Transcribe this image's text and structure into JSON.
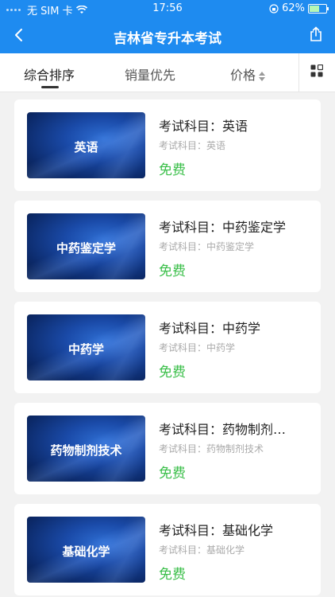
{
  "status": {
    "carrier": "无 SIM 卡",
    "time": "17:56",
    "battery": "62%",
    "battery_level": 0.62
  },
  "header": {
    "title": "吉林省专升本考试"
  },
  "tabs": [
    {
      "label": "综合排序",
      "active": true
    },
    {
      "label": "销量优先",
      "active": false
    },
    {
      "label": "价格",
      "active": false
    }
  ],
  "items": [
    {
      "thumb": "英语",
      "title": "考试科目：英语",
      "subtitle": "考试科目：英语",
      "price": "免费"
    },
    {
      "thumb": "中药鉴定学",
      "title": "考试科目：中药鉴定学",
      "subtitle": "考试科目：中药鉴定学",
      "price": "免费"
    },
    {
      "thumb": "中药学",
      "title": "考试科目：中药学",
      "subtitle": "考试科目：中药学",
      "price": "免费"
    },
    {
      "thumb": "药物制剂技术",
      "title": "考试科目：药物制剂…",
      "subtitle": "考试科目：药物制剂技术",
      "price": "免费"
    },
    {
      "thumb": "基础化学",
      "title": "考试科目：基础化学",
      "subtitle": "考试科目：基础化学",
      "price": "免费"
    }
  ],
  "colors": {
    "header": "#1E8BF0",
    "price": "#3bbf4a"
  }
}
